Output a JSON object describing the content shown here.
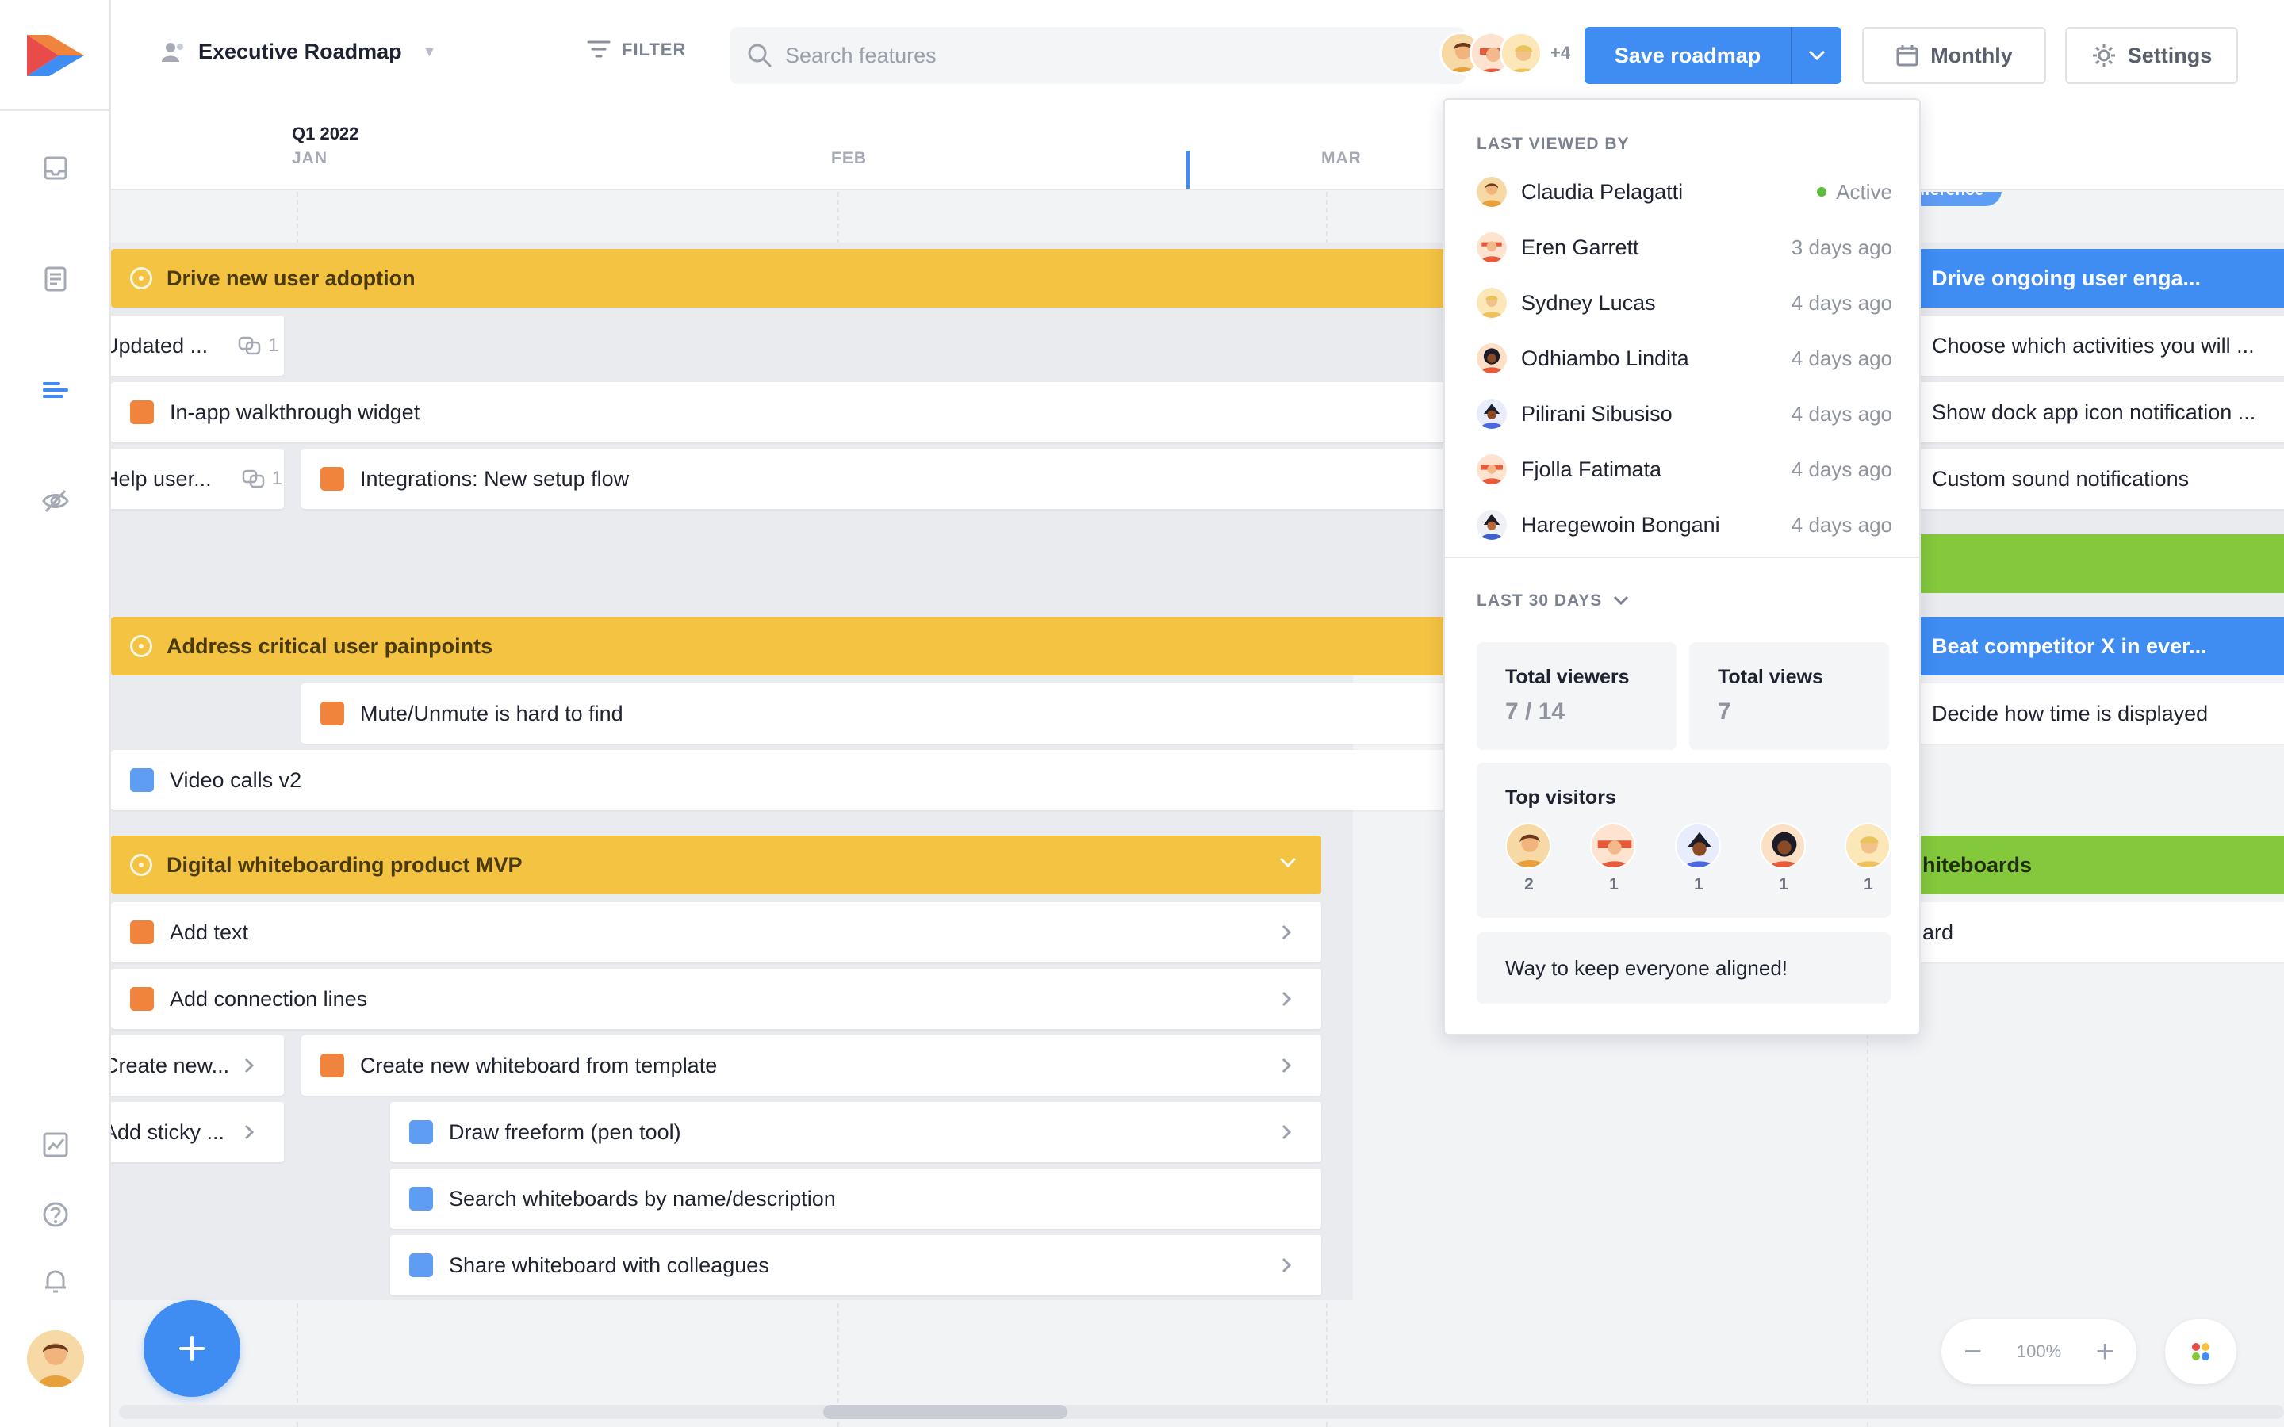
{
  "app": {
    "brand": "Airfocus"
  },
  "header": {
    "roadmap_name": "Executive Roadmap",
    "filter_label": "FILTER",
    "search_placeholder": "Search features",
    "extra_viewers": "+4",
    "save_label": "Save roadmap",
    "view_label": "Monthly",
    "settings_label": "Settings"
  },
  "timeline": {
    "quarter": "Q1 2022",
    "months": [
      "JAN",
      "FEB",
      "MAR"
    ]
  },
  "groups": [
    {
      "title": "Drive new user adoption",
      "items": [
        {
          "title": "Updated ...",
          "links": "1"
        },
        {
          "title": "In-app walkthrough widget"
        },
        {
          "title": "Help user...",
          "links": "1"
        },
        {
          "title": "Integrations: New setup flow"
        }
      ]
    },
    {
      "title": "Address critical user painpoints",
      "items": [
        {
          "title": "Mute/Unmute is hard to find"
        },
        {
          "title": "Video calls v2"
        }
      ]
    },
    {
      "title": "Digital whiteboarding product MVP",
      "items": [
        {
          "title": "Add text"
        },
        {
          "title": "Add connection lines"
        },
        {
          "title": "Create new..."
        },
        {
          "title": "Create new whiteboard from template"
        },
        {
          "title": "Add sticky ..."
        },
        {
          "title": "Draw freeform (pen tool)"
        },
        {
          "title": "Search whiteboards by name/description"
        },
        {
          "title": "Share whiteboard with colleagues"
        }
      ]
    }
  ],
  "right_column": {
    "milestone": "nference",
    "group1": "Drive ongoing user enga...",
    "items1": [
      "Choose which activities you will ...",
      "Show dock app icon notification ...",
      "Custom sound notifications"
    ],
    "group2": "Beat competitor X in ever...",
    "items2": [
      "Decide how time is displayed"
    ],
    "group3": "hiteboards",
    "items3": [
      "ard"
    ]
  },
  "popover": {
    "last_viewed_title": "LAST VIEWED BY",
    "viewers": [
      {
        "name": "Claudia Pelagatti",
        "time": "Active"
      },
      {
        "name": "Eren Garrett",
        "time": "3 days ago"
      },
      {
        "name": "Sydney Lucas",
        "time": "4 days ago"
      },
      {
        "name": "Odhiambo Lindita",
        "time": "4 days ago"
      },
      {
        "name": "Pilirani Sibusiso",
        "time": "4 days ago"
      },
      {
        "name": "Fjolla Fatimata",
        "time": "4 days ago"
      },
      {
        "name": "Haregewoin Bongani",
        "time": "4 days ago"
      }
    ],
    "period_label": "LAST 30 DAYS",
    "total_viewers_label": "Total viewers",
    "total_viewers_value": "7 / 14",
    "total_views_label": "Total views",
    "total_views_value": "7",
    "top_visitors_label": "Top visitors",
    "top_visitor_counts": [
      "2",
      "1",
      "1",
      "1",
      "1"
    ],
    "note": "Way to keep everyone aligned!"
  },
  "zoom": {
    "level": "100%"
  },
  "colors": {
    "accent": "#3f8cf2",
    "objective": "#f5c342",
    "feature_orange": "#f0843c",
    "feature_blue": "#5f9cf4",
    "green": "#84c83c",
    "active": "#5cbc3a"
  }
}
